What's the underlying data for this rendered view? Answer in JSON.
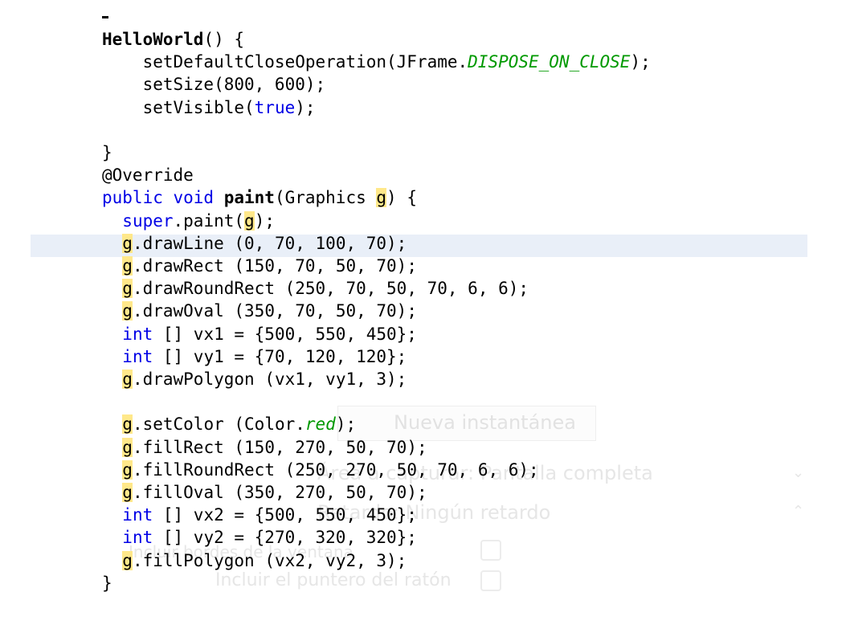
{
  "code_lines": [
    {
      "parts": [
        {
          "t": "HelloWorld",
          "c": "bold"
        },
        {
          "t": "() {",
          "c": ""
        }
      ]
    },
    {
      "parts": [
        {
          "t": "    setDefaultCloseOperation(JFrame.",
          "c": ""
        },
        {
          "t": "DISPOSE_ON_CLOSE",
          "c": "const"
        },
        {
          "t": ");",
          "c": ""
        }
      ]
    },
    {
      "parts": [
        {
          "t": "    setSize(800, 600);",
          "c": ""
        }
      ]
    },
    {
      "parts": [
        {
          "t": "    setVisible(",
          "c": ""
        },
        {
          "t": "true",
          "c": "kw"
        },
        {
          "t": ");",
          "c": ""
        }
      ]
    },
    {
      "parts": [
        {
          "t": "",
          "c": ""
        }
      ]
    },
    {
      "parts": [
        {
          "t": "}",
          "c": ""
        }
      ]
    },
    {
      "parts": [
        {
          "t": "@Override",
          "c": ""
        }
      ]
    },
    {
      "parts": [
        {
          "t": "public void ",
          "c": "kw"
        },
        {
          "t": "paint",
          "c": "bold"
        },
        {
          "t": "(Graphics ",
          "c": ""
        },
        {
          "t": "g",
          "c": "mark"
        },
        {
          "t": ") {",
          "c": ""
        }
      ]
    },
    {
      "parts": [
        {
          "t": "  ",
          "c": ""
        },
        {
          "t": "super",
          "c": "kw"
        },
        {
          "t": ".paint(",
          "c": ""
        },
        {
          "t": "g",
          "c": "mark"
        },
        {
          "t": ");",
          "c": ""
        }
      ]
    },
    {
      "parts": [
        {
          "t": "  ",
          "c": ""
        },
        {
          "t": "g",
          "c": "mark caret"
        },
        {
          "t": ".drawLine (0, 70, 100, 70);",
          "c": ""
        }
      ],
      "current": true
    },
    {
      "parts": [
        {
          "t": "  ",
          "c": ""
        },
        {
          "t": "g",
          "c": "mark"
        },
        {
          "t": ".drawRect (150, 70, 50, 70);",
          "c": ""
        }
      ]
    },
    {
      "parts": [
        {
          "t": "  ",
          "c": ""
        },
        {
          "t": "g",
          "c": "mark"
        },
        {
          "t": ".drawRoundRect (250, 70, 50, 70, 6, 6);",
          "c": ""
        }
      ]
    },
    {
      "parts": [
        {
          "t": "  ",
          "c": ""
        },
        {
          "t": "g",
          "c": "mark"
        },
        {
          "t": ".drawOval (350, 70, 50, 70);",
          "c": ""
        }
      ]
    },
    {
      "parts": [
        {
          "t": "  ",
          "c": ""
        },
        {
          "t": "int",
          "c": "kw"
        },
        {
          "t": " [] vx1 = {500, 550, 450};",
          "c": ""
        }
      ]
    },
    {
      "parts": [
        {
          "t": "  ",
          "c": ""
        },
        {
          "t": "int",
          "c": "kw"
        },
        {
          "t": " [] vy1 = {70, 120, 120};",
          "c": ""
        }
      ]
    },
    {
      "parts": [
        {
          "t": "  ",
          "c": ""
        },
        {
          "t": "g",
          "c": "mark"
        },
        {
          "t": ".drawPolygon (vx1, vy1, 3);",
          "c": ""
        }
      ]
    },
    {
      "parts": [
        {
          "t": "",
          "c": ""
        }
      ]
    },
    {
      "parts": [
        {
          "t": "  ",
          "c": ""
        },
        {
          "t": "g",
          "c": "mark"
        },
        {
          "t": ".setColor (Color.",
          "c": ""
        },
        {
          "t": "red",
          "c": "const"
        },
        {
          "t": ");",
          "c": ""
        }
      ]
    },
    {
      "parts": [
        {
          "t": "  ",
          "c": ""
        },
        {
          "t": "g",
          "c": "mark"
        },
        {
          "t": ".fillRect (150, 270, 50, 70);",
          "c": ""
        }
      ]
    },
    {
      "parts": [
        {
          "t": "  ",
          "c": ""
        },
        {
          "t": "g",
          "c": "mark"
        },
        {
          "t": ".fillRoundRect (250, 270, 50, 70, 6, 6);",
          "c": ""
        }
      ]
    },
    {
      "parts": [
        {
          "t": "  ",
          "c": ""
        },
        {
          "t": "g",
          "c": "mark"
        },
        {
          "t": ".fillOval (350, 270, 50, 70);",
          "c": ""
        }
      ]
    },
    {
      "parts": [
        {
          "t": "  ",
          "c": ""
        },
        {
          "t": "int",
          "c": "kw"
        },
        {
          "t": " [] vx2 = {500, 550, 450};",
          "c": ""
        }
      ]
    },
    {
      "parts": [
        {
          "t": "  ",
          "c": ""
        },
        {
          "t": "int",
          "c": "kw"
        },
        {
          "t": " [] vy2 = {270, 320, 320};",
          "c": ""
        }
      ]
    },
    {
      "parts": [
        {
          "t": "  ",
          "c": ""
        },
        {
          "t": "g",
          "c": "mark"
        },
        {
          "t": ".fillPolygon (vx2, vy2, 3);",
          "c": ""
        }
      ]
    },
    {
      "parts": [
        {
          "t": "}",
          "c": ""
        }
      ]
    }
  ],
  "ghost": {
    "title": "Nueva instantánea",
    "row1": "Área a capturar: Pantalla completa",
    "row2": "Retardo: Ningún retardo",
    "row3": "Incluir bordes de la ventana",
    "row4": "Incluir el puntero del ratón",
    "chevron_down": "⌄",
    "chevron_up": "⌃"
  },
  "colors": {
    "keyword": "#0000e6",
    "constant": "#009900",
    "highlight": "#ffe88a",
    "current_line": "#e9eff8"
  }
}
